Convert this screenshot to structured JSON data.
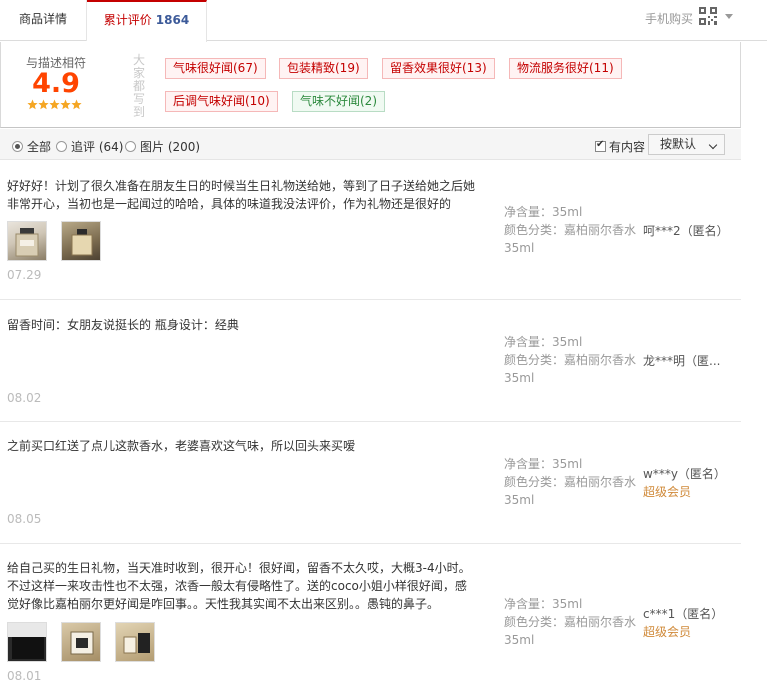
{
  "tabs": {
    "detail": "商品详情",
    "reviews_label": "累计评价",
    "reviews_count": "1864"
  },
  "mobile_buy": "手机购买",
  "rating": {
    "label": "与描述相符",
    "score": "4.9",
    "stars": 5
  },
  "impressions_label": "大家都写到",
  "tags": [
    {
      "label": "气味很好闻(67)",
      "sentiment": "positive"
    },
    {
      "label": "包装精致(19)",
      "sentiment": "positive"
    },
    {
      "label": "留香效果很好(13)",
      "sentiment": "positive"
    },
    {
      "label": "物流服务很好(11)",
      "sentiment": "positive"
    },
    {
      "label": "后调气味好闻(10)",
      "sentiment": "positive"
    },
    {
      "label": "气味不好闻(2)",
      "sentiment": "neutral"
    }
  ],
  "filters": {
    "all": "全部",
    "followup": "追评 (64)",
    "pictures": "图片 (200)",
    "has_content": "有内容",
    "sort": "按默认"
  },
  "reviews": [
    {
      "text": "好好好！计划了很久准备在朋友生日的时候当生日礼物送给她，等到了日子送给她之后她非常开心，当初也是一起闻过的哈哈，具体的味道我没法评价，作为礼物还是很好的",
      "date": "07.29",
      "volume": "净含量：35ml",
      "color": "颜色分类：嘉柏丽尔香水35ml",
      "user": "呵***2（匿名）",
      "vip": ""
    },
    {
      "text": "留香时间：女朋友说挺长的 瓶身设计：经典",
      "date": "08.02",
      "volume": "净含量：35ml",
      "color": "颜色分类：嘉柏丽尔香水35ml",
      "user": "龙***明（匿...",
      "vip": ""
    },
    {
      "text": "之前买口红送了点儿这款香水，老婆喜欢这气味，所以回头来买嗳",
      "date": "08.05",
      "volume": "净含量：35ml",
      "color": "颜色分类：嘉柏丽尔香水35ml",
      "user": "w***y（匿名）",
      "vip": "超级会员"
    },
    {
      "text": "给自己买的生日礼物，当天准时收到，很开心！很好闻，留香不太久哎，大概3-4小时。不过这样一来攻击性也不太强，浓香一般太有侵略性了。送的coco小姐小样很好闻，感觉好像比嘉柏丽尔更好闻是咋回事。。天性我其实闻不太出来区别。。愚钝的鼻子。",
      "date": "08.01",
      "volume": "净含量：35ml",
      "color": "颜色分类：嘉柏丽尔香水35ml",
      "user": "c***1（匿名）",
      "vip": "超级会员"
    }
  ],
  "colors": {
    "accent_red": "#c40000",
    "score_orange": "#ff4400",
    "vip_gold": "#d08a3a"
  }
}
